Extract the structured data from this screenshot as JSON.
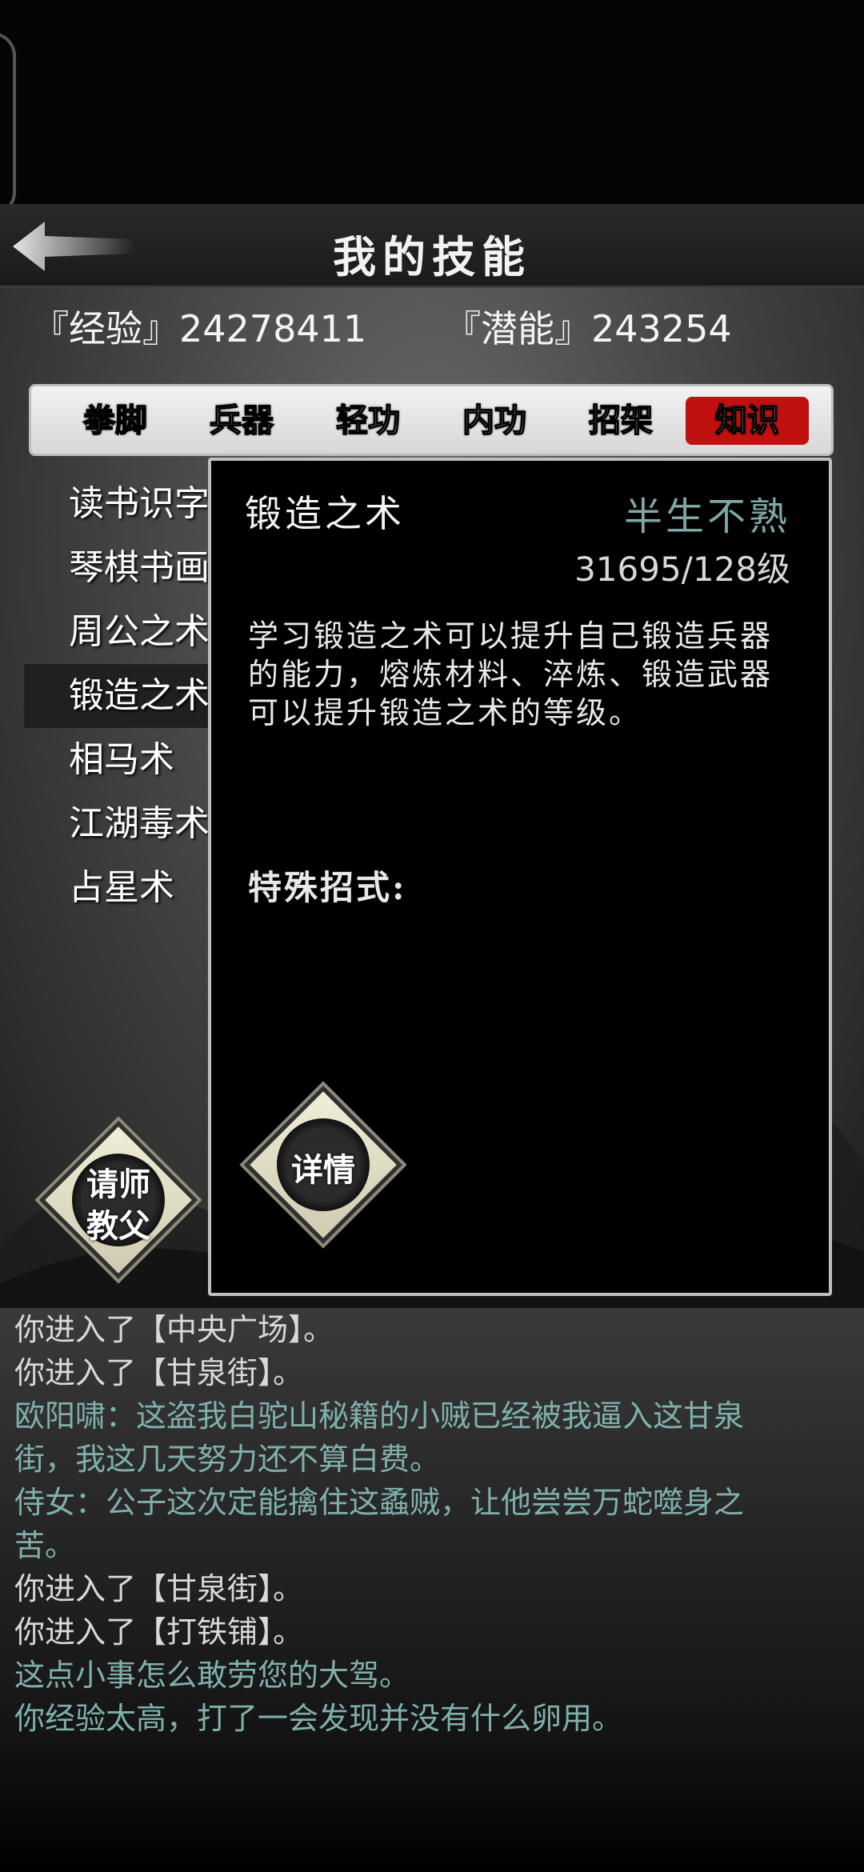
{
  "header": {
    "title": "我的技能",
    "back_icon": "back-arrow-icon"
  },
  "stats": {
    "experience": "『经验』24278411",
    "potential": "『潜能』243254"
  },
  "tabs": [
    {
      "label": "拳脚",
      "active": false
    },
    {
      "label": "兵器",
      "active": false
    },
    {
      "label": "轻功",
      "active": false
    },
    {
      "label": "内功",
      "active": false
    },
    {
      "label": "招架",
      "active": false
    },
    {
      "label": "知识",
      "active": true
    }
  ],
  "skills": [
    {
      "label": "读书识字"
    },
    {
      "label": "琴棋书画"
    },
    {
      "label": "周公之术"
    },
    {
      "label": "锻造之术",
      "selected": true
    },
    {
      "label": "相马术"
    },
    {
      "label": "江湖毒术"
    },
    {
      "label": "占星术"
    }
  ],
  "detail": {
    "name": "锻造之术",
    "rank": "半生不熟",
    "level": "31695/128级",
    "description": "学习锻造之术可以提升自己锻造兵器的能力，熔炼材料、淬炼、锻造武器可以提升锻造之术的等级。",
    "special_label": "特殊招式:",
    "details_button": "详情"
  },
  "teacher_button": {
    "line1": "请师",
    "line2": "教父"
  },
  "log": [
    {
      "text": "你进入了【中央广场】。",
      "type": "plain"
    },
    {
      "text": "你进入了【甘泉街】。",
      "type": "plain"
    },
    {
      "text": "欧阳啸：这盗我白驼山秘籍的小贼已经被我逼入这甘泉",
      "type": "npc"
    },
    {
      "text": "街，我这几天努力还不算白费。",
      "type": "npc"
    },
    {
      "text": "侍女：公子这次定能擒住这蟊贼，让他尝尝万蛇噬身之",
      "type": "npc"
    },
    {
      "text": "苦。",
      "type": "npc"
    },
    {
      "text": "你进入了【甘泉街】。",
      "type": "plain"
    },
    {
      "text": "你进入了【打铁铺】。",
      "type": "plain"
    },
    {
      "text": "这点小事怎么敢劳您的大驾。",
      "type": "npc"
    },
    {
      "text": "你经验太高，打了一会发现并没有什么卵用。",
      "type": "npc"
    }
  ],
  "colors": {
    "active_tab": "#c01010",
    "rank_text": "#7fa6a2",
    "npc_text": "#7fb0ac"
  }
}
